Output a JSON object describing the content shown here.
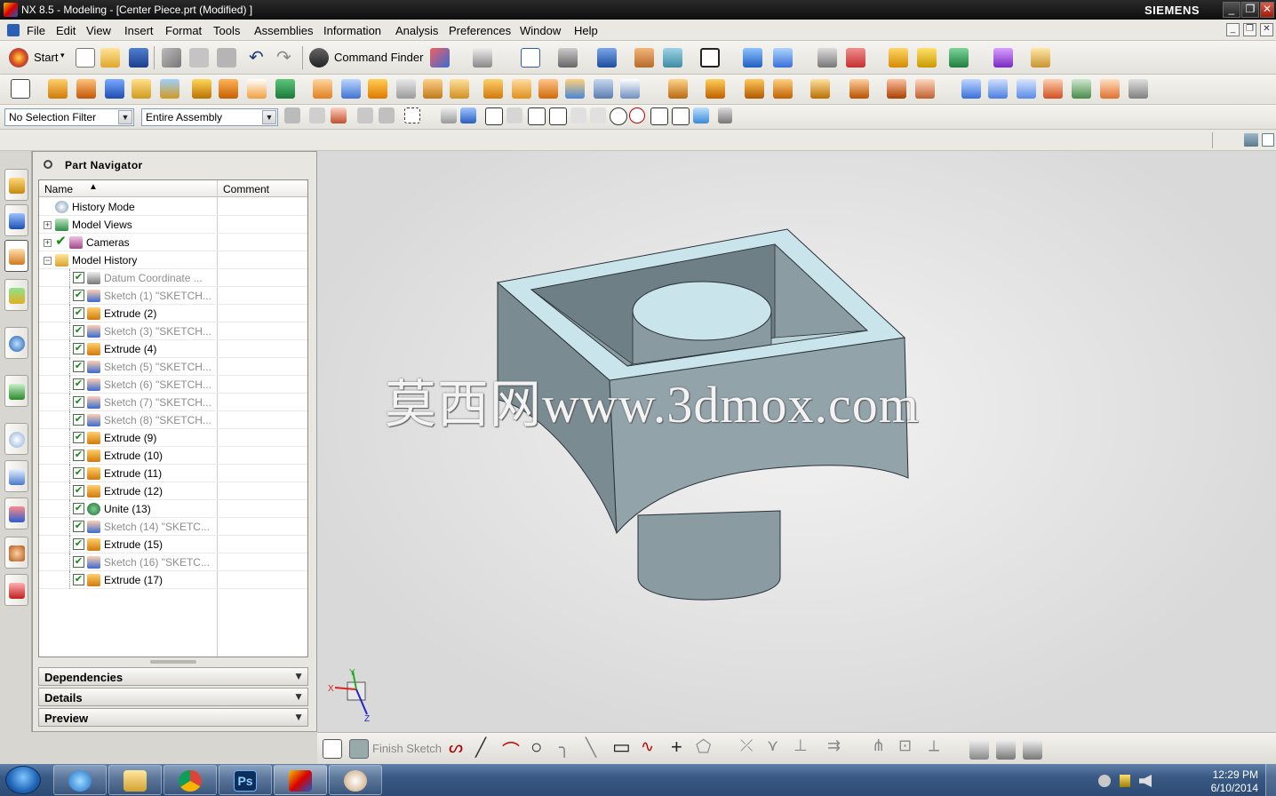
{
  "window": {
    "title": "NX 8.5 - Modeling - [Center Piece.prt (Modified) ]",
    "brand": "SIEMENS",
    "controls": [
      "_",
      "❐",
      "✕"
    ]
  },
  "menubar": {
    "items": [
      "File",
      "Edit",
      "View",
      "Insert",
      "Format",
      "Tools",
      "Assemblies",
      "Information",
      "Analysis",
      "Preferences",
      "Window",
      "Help"
    ]
  },
  "toolbar": {
    "start_label": "Start",
    "command_finder_label": "Command Finder"
  },
  "selection_bar": {
    "filter_value": "No Selection Filter",
    "scope_value": "Entire Assembly"
  },
  "navigator": {
    "title": "Part Navigator",
    "columns": [
      "Name",
      "Comment"
    ],
    "rows": [
      {
        "label": "History Mode",
        "level": 0,
        "icon": "clock-icon",
        "dim": false,
        "expander": "",
        "check": false
      },
      {
        "label": "Model Views",
        "level": 0,
        "icon": "model-views-icon",
        "dim": false,
        "expander": "+",
        "check": false
      },
      {
        "label": "Cameras",
        "level": 0,
        "icon": "cameras-icon",
        "dim": false,
        "expander": "+",
        "check": true
      },
      {
        "label": "Model History",
        "level": 0,
        "icon": "folder-icon",
        "dim": false,
        "expander": "−",
        "check": false
      },
      {
        "label": "Datum Coordinate ...",
        "level": 1,
        "icon": "datum-csys-icon",
        "dim": true,
        "expander": "",
        "check": true
      },
      {
        "label": "Sketch (1) \"SKETCH...",
        "level": 1,
        "icon": "sketch-icon",
        "dim": true,
        "expander": "",
        "check": true
      },
      {
        "label": "Extrude (2)",
        "level": 1,
        "icon": "extrude-icon",
        "dim": false,
        "expander": "",
        "check": true
      },
      {
        "label": "Sketch (3) \"SKETCH...",
        "level": 1,
        "icon": "sketch-icon",
        "dim": true,
        "expander": "",
        "check": true
      },
      {
        "label": "Extrude (4)",
        "level": 1,
        "icon": "extrude-icon",
        "dim": false,
        "expander": "",
        "check": true
      },
      {
        "label": "Sketch (5) \"SKETCH...",
        "level": 1,
        "icon": "sketch-icon",
        "dim": true,
        "expander": "",
        "check": true
      },
      {
        "label": "Sketch (6) \"SKETCH...",
        "level": 1,
        "icon": "sketch-icon",
        "dim": true,
        "expander": "",
        "check": true
      },
      {
        "label": "Sketch (7) \"SKETCH...",
        "level": 1,
        "icon": "sketch-icon",
        "dim": true,
        "expander": "",
        "check": true
      },
      {
        "label": "Sketch (8) \"SKETCH...",
        "level": 1,
        "icon": "sketch-icon",
        "dim": true,
        "expander": "",
        "check": true
      },
      {
        "label": "Extrude (9)",
        "level": 1,
        "icon": "extrude-icon",
        "dim": false,
        "expander": "",
        "check": true
      },
      {
        "label": "Extrude (10)",
        "level": 1,
        "icon": "extrude-icon",
        "dim": false,
        "expander": "",
        "check": true
      },
      {
        "label": "Extrude (11)",
        "level": 1,
        "icon": "extrude-icon",
        "dim": false,
        "expander": "",
        "check": true
      },
      {
        "label": "Extrude (12)",
        "level": 1,
        "icon": "extrude-icon",
        "dim": false,
        "expander": "",
        "check": true
      },
      {
        "label": "Unite (13)",
        "level": 1,
        "icon": "unite-icon",
        "dim": false,
        "expander": "",
        "check": true
      },
      {
        "label": "Sketch (14) \"SKETC...",
        "level": 1,
        "icon": "sketch-icon",
        "dim": true,
        "expander": "",
        "check": true
      },
      {
        "label": "Extrude (15)",
        "level": 1,
        "icon": "extrude-icon",
        "dim": false,
        "expander": "",
        "check": true
      },
      {
        "label": "Sketch (16) \"SKETC...",
        "level": 1,
        "icon": "sketch-icon",
        "dim": true,
        "expander": "",
        "check": true
      },
      {
        "label": "Extrude (17)",
        "level": 1,
        "icon": "extrude-icon",
        "dim": false,
        "expander": "",
        "check": true
      }
    ],
    "panels": [
      "Dependencies",
      "Details",
      "Preview"
    ]
  },
  "viewport": {
    "watermark": "莫西网www.3dmox.com",
    "triad": {
      "x_label": "X",
      "y_label": "Y",
      "z_label": "Z"
    },
    "model_colors": {
      "face_dark": "#7b8b92",
      "face_mid": "#93a3aa",
      "face_top": "#c9e4ea",
      "edge": "#2a3338"
    }
  },
  "sketch_toolbar": {
    "finish_label": "Finish Sketch"
  },
  "taskbar": {
    "time": "12:29 PM",
    "date": "6/10/2014",
    "apps": [
      "internet-explorer-icon",
      "file-explorer-icon",
      "chrome-icon",
      "photoshop-icon",
      "nx-icon",
      "paint-icon"
    ],
    "photoshop_label": "Ps"
  },
  "colors": {
    "accent": "#2b5fb3",
    "check_green": "#118a11",
    "extrude_orange": "#e08a1e"
  }
}
